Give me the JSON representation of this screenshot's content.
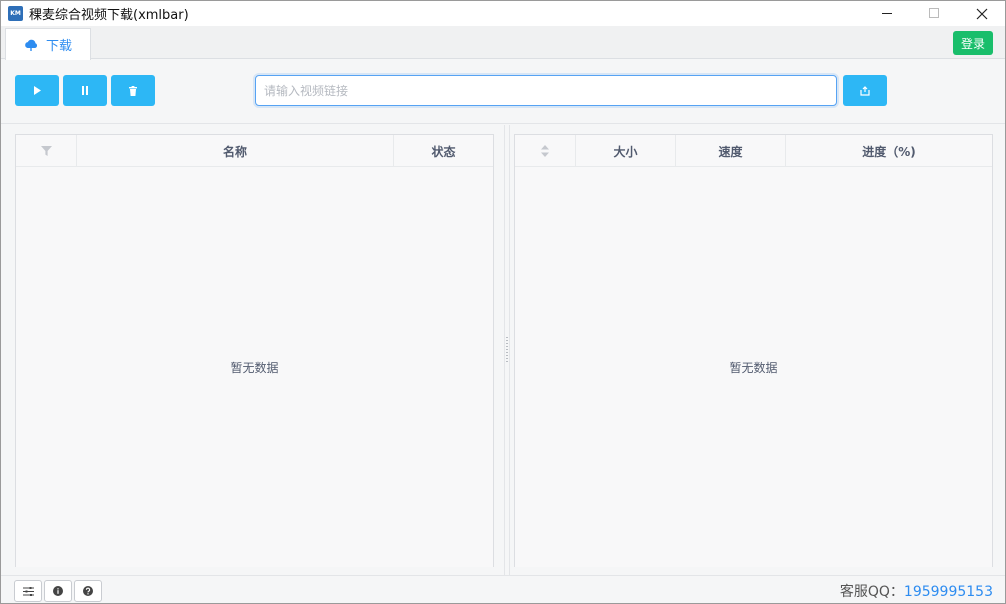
{
  "window": {
    "app_icon_text": "KM",
    "title": "稞麦综合视频下载(xmlbar)"
  },
  "tabs": [
    {
      "label": "下载",
      "icon": "cloud-icon",
      "active": true
    }
  ],
  "header": {
    "login_label": "登录"
  },
  "toolbar": {
    "buttons": [
      {
        "name": "start-button",
        "icon": "play-icon"
      },
      {
        "name": "pause-button",
        "icon": "pause-icon"
      },
      {
        "name": "delete-button",
        "icon": "trash-icon"
      }
    ],
    "url_input": {
      "value": "",
      "placeholder": "请输入视频链接"
    },
    "submit_icon": "export-icon"
  },
  "left_table": {
    "columns": [
      "",
      "名称",
      "状态"
    ],
    "filter_icon": "filter-icon",
    "empty_text": "暂无数据"
  },
  "right_table": {
    "columns": [
      "",
      "大小",
      "速度",
      "进度（%)"
    ],
    "sort_icon": "sort-icon",
    "empty_text": "暂无数据"
  },
  "statusbar": {
    "buttons": [
      "settings-icon",
      "info-icon",
      "help-icon"
    ],
    "qq_label": "客服QQ：",
    "qq_number": "1959995153"
  },
  "colors": {
    "primary_button": "#2db7f5",
    "login_button": "#19be6b",
    "accent": "#2d8cf0"
  }
}
